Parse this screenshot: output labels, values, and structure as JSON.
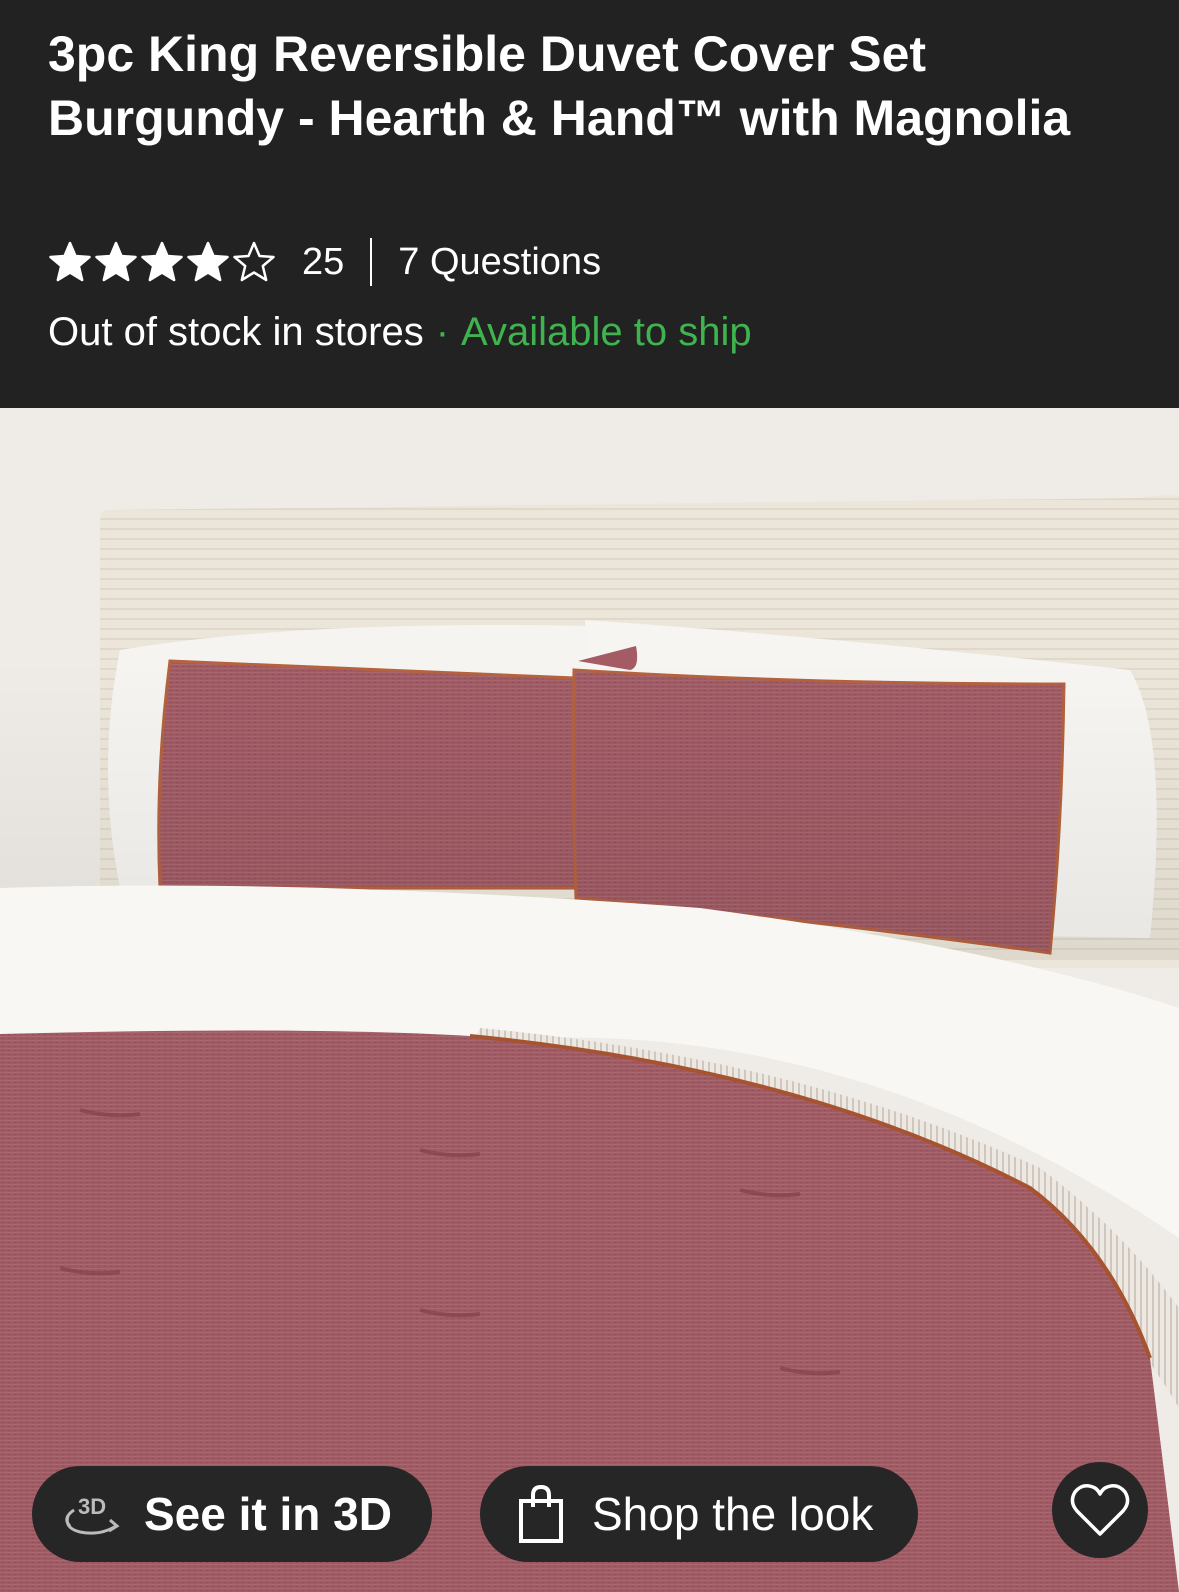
{
  "product": {
    "title": "3pc King Reversible Duvet Cover Set Burgundy - Hearth & Hand™ with Magnolia",
    "rating": 4,
    "rating_max": 5,
    "review_count": "25",
    "questions": "7 Questions",
    "stock_status": "Out of stock in stores",
    "separator": "·",
    "ship_status": "Available to ship"
  },
  "image": {
    "alt_subject": "burgundy-duvet-bed-photo"
  },
  "actions": {
    "see_3d_label": "See it in 3D",
    "three_d_badge": "3D",
    "shop_look_label": "Shop the look",
    "favorite_icon": "heart-icon"
  },
  "colors": {
    "header_bg": "#222222",
    "accent_green": "#3fb44e",
    "burgundy": "#9d5560",
    "button_bg": "#262626"
  }
}
